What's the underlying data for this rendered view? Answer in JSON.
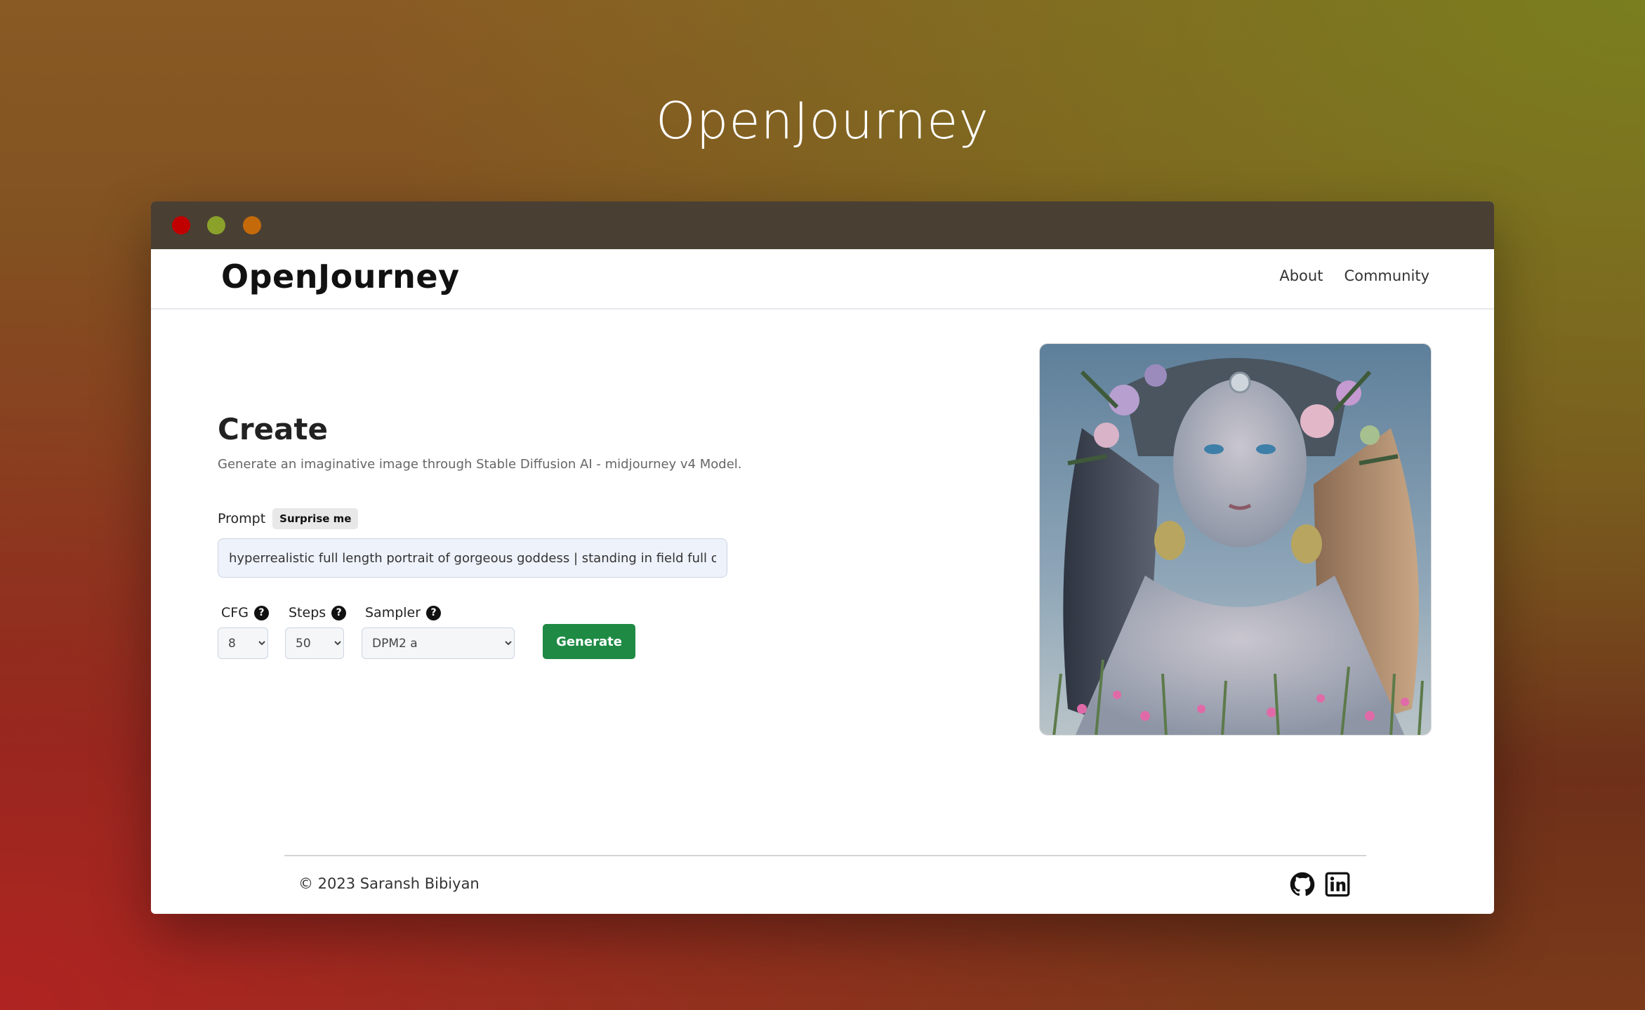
{
  "hero": {
    "title": "OpenJourney"
  },
  "navbar": {
    "brand": "OpenJourney",
    "links": [
      "About",
      "Community"
    ]
  },
  "create": {
    "title": "Create",
    "subtitle": "Generate an imaginative image through Stable Diffusion AI - midjourney v4 Model.",
    "prompt_label": "Prompt",
    "surprise_label": "Surprise me",
    "prompt_value": "hyperrealistic full length portrait of gorgeous goddess | standing in field full of flowers"
  },
  "controls": {
    "cfg": {
      "label": "CFG",
      "value": "8"
    },
    "steps": {
      "label": "Steps",
      "value": "50"
    },
    "sampler": {
      "label": "Sampler",
      "value": "DPM2 a"
    },
    "generate_label": "Generate"
  },
  "footer": {
    "copyright": "© 2023 Saransh Bibiyan",
    "icons": [
      "github-icon",
      "linkedin-icon"
    ]
  },
  "colors": {
    "accent": "#1e8a44",
    "titlebar": "#4a3f33",
    "dot_red": "#c00000",
    "dot_green": "#8aa22a",
    "dot_orange": "#c56a0a"
  }
}
